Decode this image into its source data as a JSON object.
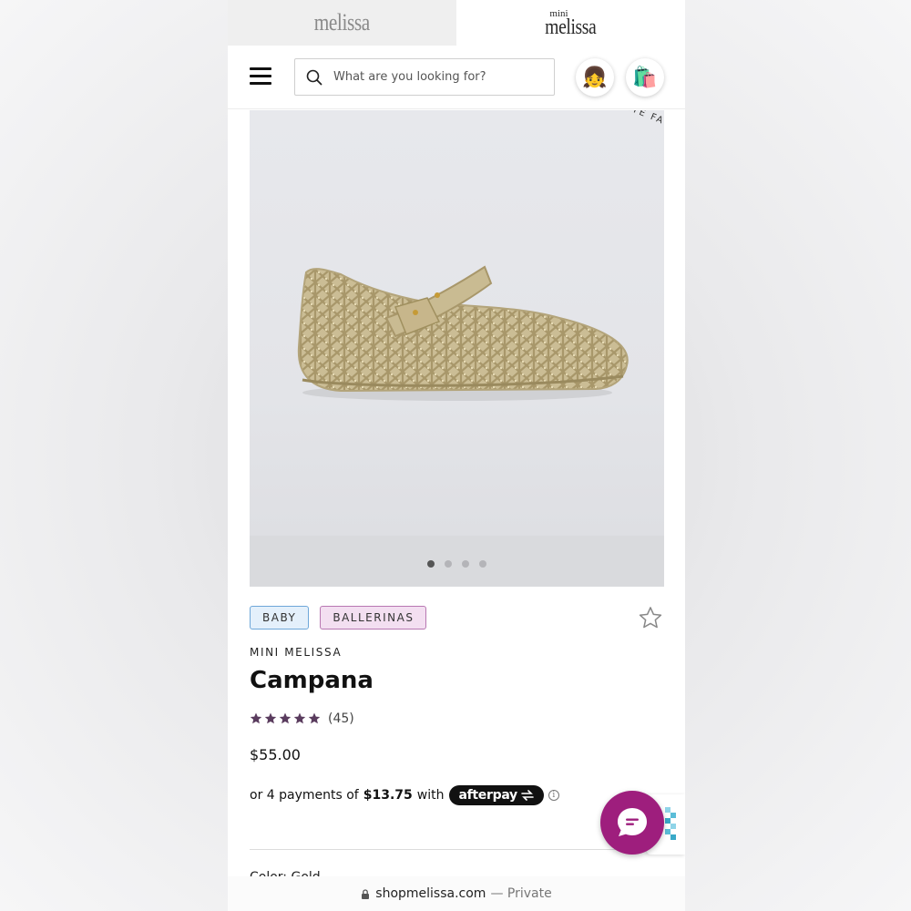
{
  "brand_tabs": [
    {
      "label": "melissa",
      "active": false
    },
    {
      "label": "mini",
      "sublabel": "melissa",
      "active": true
    }
  ],
  "header": {
    "search_placeholder": "What are you looking for?",
    "account_icon": "girl-emoji-icon",
    "bag_icon": "shopping-bags-icon"
  },
  "carousel": {
    "badge_text": "ORITE FA",
    "slide_count": 4,
    "active_slide": 1
  },
  "product": {
    "tags": [
      "BABY",
      "BALLERINAS"
    ],
    "brand": "MINI MELISSA",
    "name": "Campana",
    "rating_value": 4.5,
    "rating_max": 5,
    "rating_count": "(45)",
    "price": "$55.00",
    "installment_prefix": "or 4 payments of",
    "installment_amount": "$13.75",
    "installment_with": "with",
    "afterpay_label": "afterpay",
    "next_section_label": "Color: Gold"
  },
  "colors": {
    "chat_button": "#9e1e7d",
    "baby_tag": "#e4f0fb",
    "ballerinas_tag": "#f3dff1",
    "star": "#5a3c5e"
  },
  "browser": {
    "domain": "shopmelissa.com",
    "mode": "— Private"
  }
}
